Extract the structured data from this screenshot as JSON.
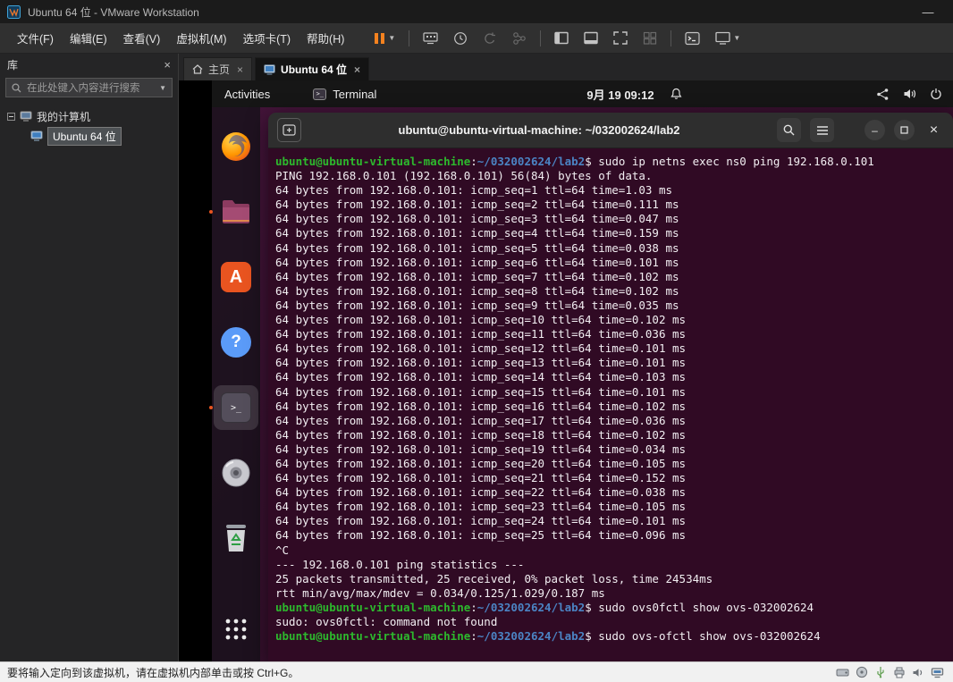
{
  "window": {
    "title": "Ubuntu 64 位 - VMware Workstation",
    "minimize_glyph": "—"
  },
  "menubar": {
    "items": [
      {
        "id": "file",
        "label": "文件(F)"
      },
      {
        "id": "edit",
        "label": "编辑(E)"
      },
      {
        "id": "view",
        "label": "查看(V)"
      },
      {
        "id": "vm",
        "label": "虚拟机(M)"
      },
      {
        "id": "tabs",
        "label": "选项卡(T)"
      },
      {
        "id": "help",
        "label": "帮助(H)"
      }
    ],
    "toolbar_icons": [
      "pause-icon",
      "send-ctrl-alt-del-icon",
      "snapshot-clock-icon",
      "revert-snapshot-icon",
      "manage-snapshots-icon",
      "console-view-icon",
      "thumbnail-view-icon",
      "fullscreen-icon",
      "unity-icon",
      "virtual-console-icon",
      "display-settings-icon"
    ]
  },
  "library": {
    "title": "库",
    "close_glyph": "×",
    "search_placeholder": "在此处键入内容进行搜索",
    "tree": {
      "root": "我的计算机",
      "vm": "Ubuntu 64 位"
    }
  },
  "tabs": [
    {
      "id": "home",
      "label": "主页",
      "close": "×"
    },
    {
      "id": "vm",
      "label": "Ubuntu 64 位",
      "close": "×",
      "active": true
    }
  ],
  "ubuntu": {
    "topbar": {
      "activities": "Activities",
      "app_name": "Terminal",
      "clock": "9月 19 09:12",
      "right_icons": [
        "network-nodes-icon",
        "volume-icon",
        "power-icon"
      ]
    },
    "dock": {
      "items": [
        "firefox",
        "files",
        "ubuntu-software",
        "help",
        "terminal",
        "media-disc",
        "trash",
        "app-grid"
      ]
    },
    "terminal": {
      "title": "ubuntu@ubuntu-virtual-machine: ~/032002624/lab2",
      "prompt": {
        "user": "ubuntu@ubuntu-virtual-machine",
        "colon": ":",
        "path": "~/032002624/lab2",
        "dollar": "$ "
      },
      "header_controls": {
        "minimize": "–",
        "close": "×"
      },
      "lines": [
        {
          "k": "cmd",
          "text": "sudo ip netns exec ns0 ping 192.168.0.101"
        },
        {
          "k": "out",
          "text": "PING 192.168.0.101 (192.168.0.101) 56(84) bytes of data."
        },
        {
          "k": "out",
          "text": "64 bytes from 192.168.0.101: icmp_seq=1 ttl=64 time=1.03 ms"
        },
        {
          "k": "out",
          "text": "64 bytes from 192.168.0.101: icmp_seq=2 ttl=64 time=0.111 ms"
        },
        {
          "k": "out",
          "text": "64 bytes from 192.168.0.101: icmp_seq=3 ttl=64 time=0.047 ms"
        },
        {
          "k": "out",
          "text": "64 bytes from 192.168.0.101: icmp_seq=4 ttl=64 time=0.159 ms"
        },
        {
          "k": "out",
          "text": "64 bytes from 192.168.0.101: icmp_seq=5 ttl=64 time=0.038 ms"
        },
        {
          "k": "out",
          "text": "64 bytes from 192.168.0.101: icmp_seq=6 ttl=64 time=0.101 ms"
        },
        {
          "k": "out",
          "text": "64 bytes from 192.168.0.101: icmp_seq=7 ttl=64 time=0.102 ms"
        },
        {
          "k": "out",
          "text": "64 bytes from 192.168.0.101: icmp_seq=8 ttl=64 time=0.102 ms"
        },
        {
          "k": "out",
          "text": "64 bytes from 192.168.0.101: icmp_seq=9 ttl=64 time=0.035 ms"
        },
        {
          "k": "out",
          "text": "64 bytes from 192.168.0.101: icmp_seq=10 ttl=64 time=0.102 ms"
        },
        {
          "k": "out",
          "text": "64 bytes from 192.168.0.101: icmp_seq=11 ttl=64 time=0.036 ms"
        },
        {
          "k": "out",
          "text": "64 bytes from 192.168.0.101: icmp_seq=12 ttl=64 time=0.101 ms"
        },
        {
          "k": "out",
          "text": "64 bytes from 192.168.0.101: icmp_seq=13 ttl=64 time=0.101 ms"
        },
        {
          "k": "out",
          "text": "64 bytes from 192.168.0.101: icmp_seq=14 ttl=64 time=0.103 ms"
        },
        {
          "k": "out",
          "text": "64 bytes from 192.168.0.101: icmp_seq=15 ttl=64 time=0.101 ms"
        },
        {
          "k": "out",
          "text": "64 bytes from 192.168.0.101: icmp_seq=16 ttl=64 time=0.102 ms"
        },
        {
          "k": "out",
          "text": "64 bytes from 192.168.0.101: icmp_seq=17 ttl=64 time=0.036 ms"
        },
        {
          "k": "out",
          "text": "64 bytes from 192.168.0.101: icmp_seq=18 ttl=64 time=0.102 ms"
        },
        {
          "k": "out",
          "text": "64 bytes from 192.168.0.101: icmp_seq=19 ttl=64 time=0.034 ms"
        },
        {
          "k": "out",
          "text": "64 bytes from 192.168.0.101: icmp_seq=20 ttl=64 time=0.105 ms"
        },
        {
          "k": "out",
          "text": "64 bytes from 192.168.0.101: icmp_seq=21 ttl=64 time=0.152 ms"
        },
        {
          "k": "out",
          "text": "64 bytes from 192.168.0.101: icmp_seq=22 ttl=64 time=0.038 ms"
        },
        {
          "k": "out",
          "text": "64 bytes from 192.168.0.101: icmp_seq=23 ttl=64 time=0.105 ms"
        },
        {
          "k": "out",
          "text": "64 bytes from 192.168.0.101: icmp_seq=24 ttl=64 time=0.101 ms"
        },
        {
          "k": "out",
          "text": "64 bytes from 192.168.0.101: icmp_seq=25 ttl=64 time=0.096 ms"
        },
        {
          "k": "out",
          "text": "^C"
        },
        {
          "k": "out",
          "text": "--- 192.168.0.101 ping statistics ---"
        },
        {
          "k": "out",
          "text": "25 packets transmitted, 25 received, 0% packet loss, time 24534ms"
        },
        {
          "k": "out",
          "text": "rtt min/avg/max/mdev = 0.034/0.125/1.029/0.187 ms"
        },
        {
          "k": "cmd",
          "text": "sudo ovs0fctl show ovs-032002624"
        },
        {
          "k": "out",
          "text": "sudo: ovs0fctl: command not found"
        },
        {
          "k": "cmd",
          "text": "sudo ovs-ofctl show ovs-032002624"
        }
      ]
    }
  },
  "statusbar": {
    "message": "要将输入定向到该虚拟机，请在虚拟机内部单击或按 Ctrl+G。",
    "device_icons": [
      "hard-disk-icon",
      "cd-rom-icon",
      "usb-icon",
      "printer-icon",
      "sound-icon",
      "network-adapter-icon"
    ]
  },
  "colors": {
    "accent_orange": "#e95420",
    "terminal_background": "#300a24",
    "prompt_green": "#2db92d",
    "path_blue": "#4b84c4"
  }
}
